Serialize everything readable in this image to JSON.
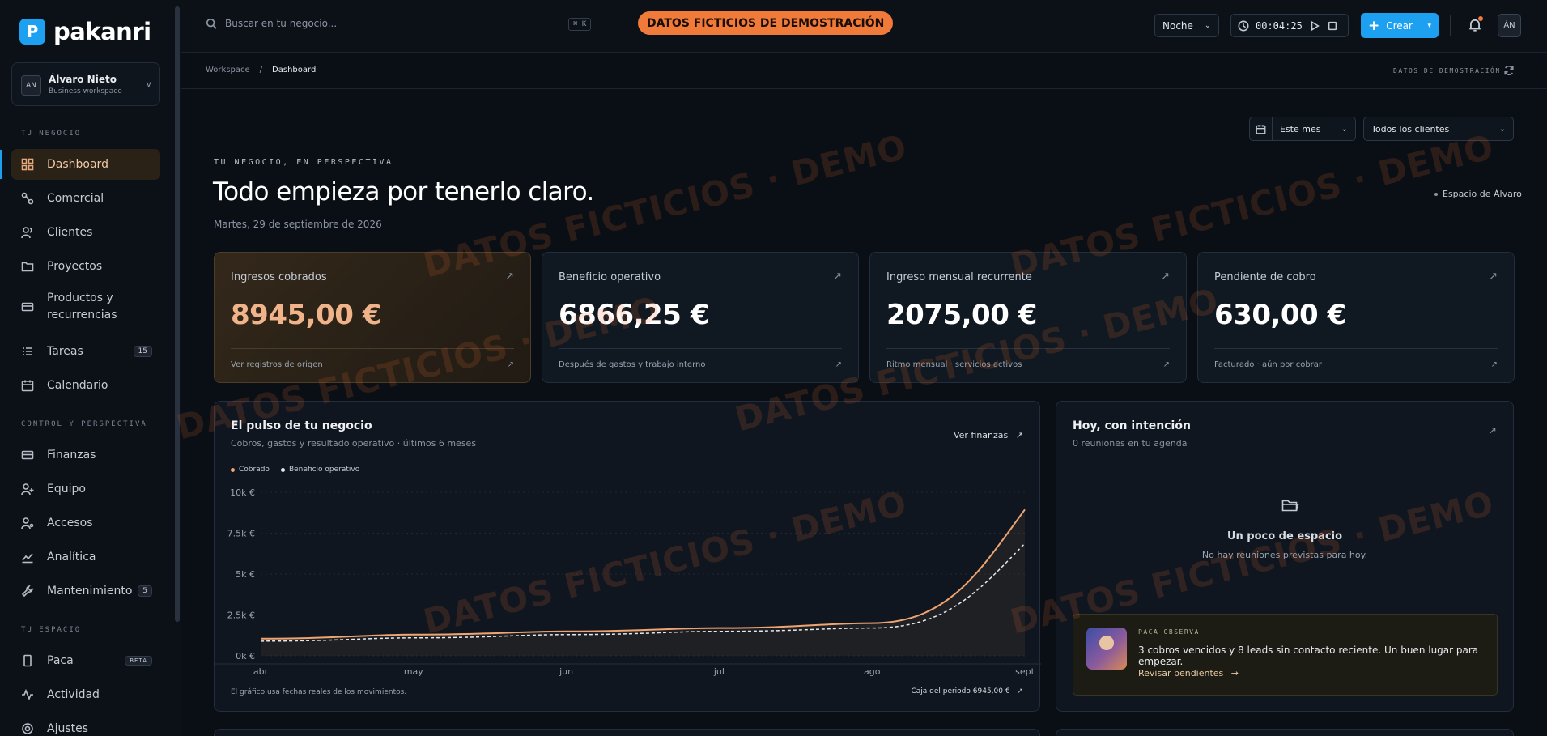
{
  "brand": {
    "name": "pakanri",
    "mark": "P"
  },
  "workspace": {
    "initials": "AN",
    "name": "Álvaro Nieto",
    "type": "Business workspace",
    "chevron": "v"
  },
  "sidebar": {
    "sections": [
      "TU NEGOCIO",
      "CONTROL Y PERSPECTIVA",
      "TU ESPACIO"
    ],
    "items": [
      {
        "label": "Dashboard",
        "icon": "grid-icon"
      },
      {
        "label": "Comercial",
        "icon": "pipeline-icon"
      },
      {
        "label": "Clientes",
        "icon": "users-icon"
      },
      {
        "label": "Proyectos",
        "icon": "folder-icon"
      },
      {
        "label": "Productos y recurrencias",
        "icon": "card-icon"
      },
      {
        "label": "Tareas",
        "icon": "list-icon",
        "badge": "15"
      },
      {
        "label": "Calendario",
        "icon": "calendar-icon"
      },
      {
        "label": "Finanzas",
        "icon": "wallet-icon"
      },
      {
        "label": "Equipo",
        "icon": "team-icon"
      },
      {
        "label": "Accesos",
        "icon": "key-icon"
      },
      {
        "label": "Analítica",
        "icon": "analytics-icon"
      },
      {
        "label": "Mantenimiento",
        "icon": "wrench-icon",
        "badge": "5"
      },
      {
        "label": "Paca",
        "icon": "phone-icon",
        "badge": "BETA"
      },
      {
        "label": "Actividad",
        "icon": "activity-icon"
      },
      {
        "label": "Ajustes",
        "icon": "settings-icon"
      }
    ]
  },
  "topbar": {
    "search_placeholder": "Buscar en tu negocio...",
    "shortcut": "⌘ K",
    "demo_banner": "DATOS FICTICIOS DE DEMOSTRACIÓN",
    "theme": "Noche",
    "timer": "00:04:25",
    "create_label": "Crear",
    "user_initials": "ÁN"
  },
  "breadcrumb": {
    "root": "Workspace",
    "sep": "/",
    "current": "Dashboard",
    "demo_tag": "DATOS DE DEMOSTRACIÓN"
  },
  "filters": {
    "period": "Este mes",
    "clients": "Todos los clientes"
  },
  "hero": {
    "eyebrow": "TU NEGOCIO, EN PERSPECTIVA",
    "title": "Todo empieza por tenerlo claro.",
    "date": "Martes, 29 de septiembre de 2026",
    "space": "Espacio de Álvaro"
  },
  "kpis": [
    {
      "label": "Ingresos cobrados",
      "value": "8945,00 €",
      "foot": "Ver registros de origen"
    },
    {
      "label": "Beneficio operativo",
      "value": "6866,25 €",
      "foot": "Después de gastos y trabajo interno"
    },
    {
      "label": "Ingreso mensual recurrente",
      "value": "2075,00 €",
      "foot": "Ritmo mensual · servicios activos"
    },
    {
      "label": "Pendiente de cobro",
      "value": "630,00 €",
      "foot": "Facturado · aún por cobrar"
    }
  ],
  "pulse": {
    "title": "El pulso de tu negocio",
    "subtitle": "Cobros, gastos y resultado operativo · últimos 6 meses",
    "link": "Ver finanzas",
    "footnote": "El gráfico usa fechas reales de los movimientos.",
    "total": "Caja del periodo 6945,00 €"
  },
  "chart_data": {
    "type": "line",
    "x": [
      "abr",
      "may",
      "jun",
      "jul",
      "ago",
      "sept"
    ],
    "y_ticks": [
      "10k €",
      "7.5k €",
      "5k €",
      "2.5k €",
      "0k €"
    ],
    "ylim": [
      0,
      10000
    ],
    "legend_position": "top-left",
    "series": [
      {
        "name": "Cobrado",
        "color": "#f0a470",
        "values": [
          1050,
          1300,
          1500,
          1700,
          2000,
          8945
        ]
      },
      {
        "name": "Beneficio operativo",
        "color": "#e6e9ee",
        "dashed": true,
        "values": [
          900,
          1100,
          1300,
          1500,
          1700,
          6866
        ]
      }
    ]
  },
  "today": {
    "title": "Hoy, con intención",
    "subtitle": "0 reuniones en tu agenda",
    "empty_title": "Un poco de espacio",
    "empty_sub": "No hay reuniones previstas para hoy."
  },
  "paca": {
    "tag": "PACA OBSERVA",
    "message": "3 cobros vencidos y 8 leads sin contacto reciente. Un buen lugar para empezar.",
    "action": "Revisar pendientes"
  },
  "watermark": "DATOS FICTICIOS · DEMO",
  "colors": {
    "accent": "#1ea0f0",
    "demo": "#f07a3a",
    "highlight": "#f1b48a"
  }
}
